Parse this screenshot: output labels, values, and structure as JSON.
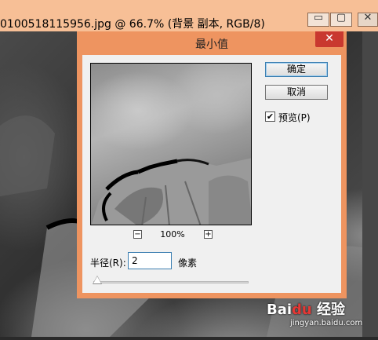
{
  "document": {
    "title": "0100518115956.jpg @ 66.7% (背景 副本, RGB/8)",
    "min_glyph": "▭",
    "max_glyph": "▢",
    "close_glyph": "✕"
  },
  "dialog": {
    "title": "最小值",
    "close_glyph": "✕",
    "ok_label": "确定",
    "cancel_label": "取消",
    "preview_checkbox_label": "预览(P)",
    "preview_checked": true,
    "zoom": "100%",
    "zoom_minus": "−",
    "zoom_plus": "+",
    "radius_label": "半径(R):",
    "radius_value": "2",
    "radius_unit": "像素"
  },
  "watermark": {
    "brand_a": "Bai",
    "brand_paw": "du",
    "brand_b": " 经验",
    "site": "jingyan.baidu.com"
  },
  "colors": {
    "titlebar": "#f7bf96",
    "dialog_frame": "#ee9460",
    "close_button": "#c9382f"
  }
}
